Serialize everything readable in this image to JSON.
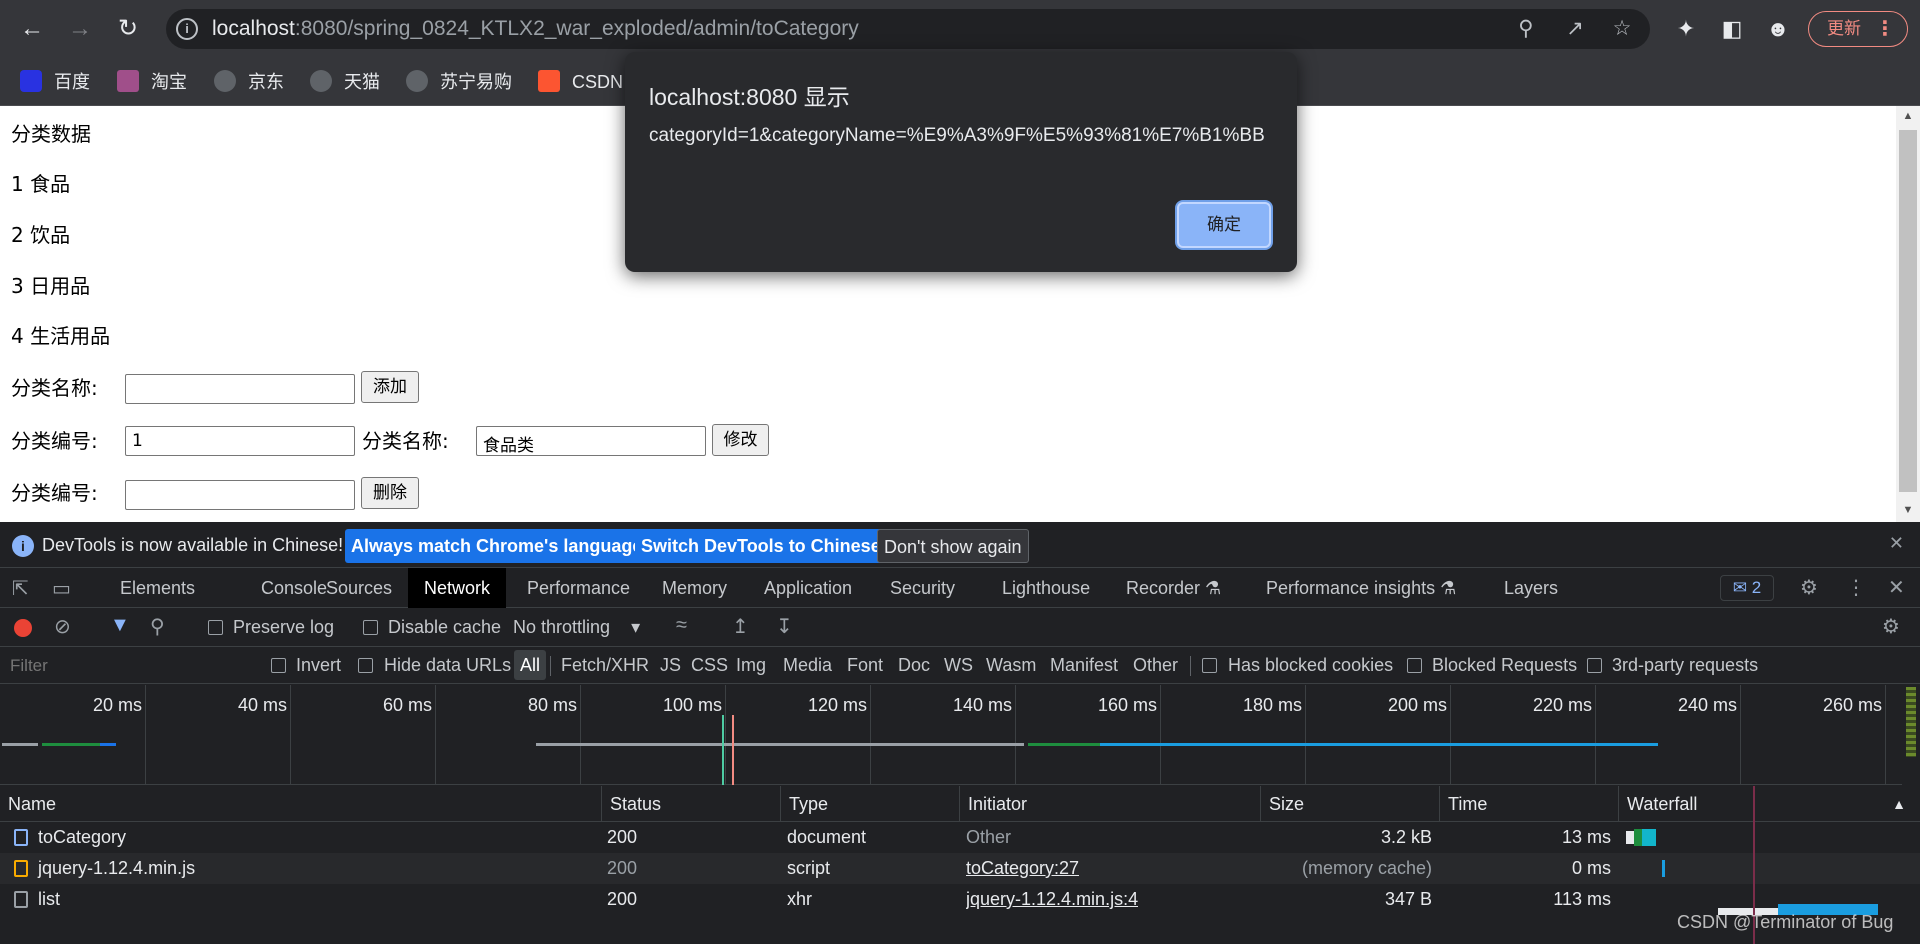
{
  "browser": {
    "url_host": "localhost",
    "url_rest": ":8080/spring_0824_KTLX2_war_exploded/admin/toCategory",
    "update_label": "更新",
    "bookmarks": [
      {
        "label": "百度",
        "color": "#2932e1"
      },
      {
        "label": "淘宝",
        "color": "#a04f8a"
      },
      {
        "label": "京东",
        "color": "#5f6368"
      },
      {
        "label": "天猫",
        "color": "#5f6368"
      },
      {
        "label": "苏宁易购",
        "color": "#5f6368"
      },
      {
        "label": "CSDN",
        "color": "#fc5531"
      }
    ]
  },
  "page": {
    "heading": "分类数据",
    "categories": [
      "1 食品",
      "2 饮品",
      "3 日用品",
      "4 生活用品"
    ],
    "add_row": {
      "label": "分类名称:",
      "value": "",
      "button": "添加"
    },
    "edit_row": {
      "id_label": "分类编号:",
      "id_value": "1",
      "name_label": "分类名称:",
      "name_value": "食品类",
      "button": "修改"
    },
    "delete_row": {
      "label": "分类编号:",
      "value": "",
      "button": "删除"
    }
  },
  "alert": {
    "title": "localhost:8080 显示",
    "message": "categoryId=1&categoryName=%E9%A3%9F%E5%93%81%E7%B1%BB",
    "ok_label": "确定"
  },
  "devtools": {
    "infobar": {
      "message": "DevTools is now available in Chinese!",
      "btn_match": "Always match Chrome's language",
      "btn_switch": "Switch DevTools to Chinese",
      "btn_dismiss": "Don't show again"
    },
    "tabs": [
      "Elements",
      "Console",
      "Sources",
      "Network",
      "Performance",
      "Memory",
      "Application",
      "Security",
      "Lighthouse",
      "Recorder",
      "Performance insights",
      "Layers"
    ],
    "issues_count": "2",
    "toolbar": {
      "preserve_log": "Preserve log",
      "disable_cache": "Disable cache",
      "throttling": "No throttling"
    },
    "filter": {
      "placeholder": "Filter",
      "invert": "Invert",
      "hide_data_urls": "Hide data URLs",
      "types": [
        "All",
        "Fetch/XHR",
        "JS",
        "CSS",
        "Img",
        "Media",
        "Font",
        "Doc",
        "WS",
        "Wasm",
        "Manifest",
        "Other"
      ],
      "blocked_cookies": "Has blocked cookies",
      "blocked_requests": "Blocked Requests",
      "third_party": "3rd-party requests"
    },
    "timeline_ticks": [
      "20 ms",
      "40 ms",
      "60 ms",
      "80 ms",
      "100 ms",
      "120 ms",
      "140 ms",
      "160 ms",
      "180 ms",
      "200 ms",
      "220 ms",
      "240 ms",
      "260 ms"
    ],
    "columns": [
      "Name",
      "Status",
      "Type",
      "Initiator",
      "Size",
      "Time",
      "Waterfall"
    ],
    "requests": [
      {
        "name": "toCategory",
        "status": "200",
        "type": "document",
        "initiator": "Other",
        "size": "3.2 kB",
        "time": "13 ms",
        "icon_color": "#8ab4f8"
      },
      {
        "name": "jquery-1.12.4.min.js",
        "status": "200",
        "type": "script",
        "initiator": "toCategory:27",
        "size": "(memory cache)",
        "time": "0 ms",
        "icon_color": "#f9ab00"
      },
      {
        "name": "list",
        "status": "200",
        "type": "xhr",
        "initiator": "jquery-1.12.4.min.js:4",
        "size": "347 B",
        "time": "113 ms",
        "icon_color": "#9aa0a6"
      }
    ]
  },
  "watermark": "CSDN @Terminator of Bug"
}
